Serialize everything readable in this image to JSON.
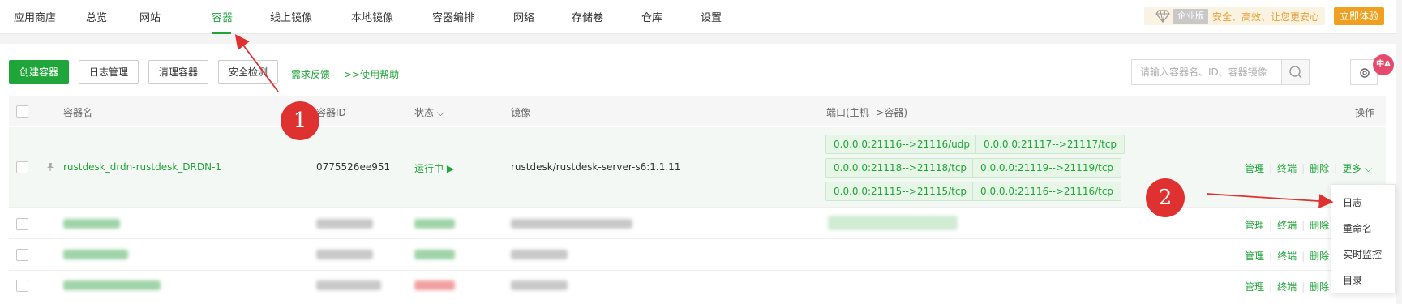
{
  "nav": {
    "items": [
      "应用商店",
      "总览",
      "网站",
      "容器",
      "线上镜像",
      "本地镜像",
      "容器编排",
      "网络",
      "存储卷",
      "仓库",
      "设置"
    ],
    "active": "容器"
  },
  "promo": {
    "tag": "企业版",
    "text": "安全、高效、让您更安心",
    "button": "立即体验"
  },
  "toolbar": {
    "create": "创建容器",
    "logs": "日志管理",
    "clean": "清理容器",
    "security": "安全检测",
    "feedback": "需求反馈",
    "help": ">>使用帮助"
  },
  "search": {
    "placeholder": "请输入容器名、ID、容器镜像"
  },
  "translate_badge": "中A",
  "table": {
    "headers": {
      "name": "容器名",
      "id": "容器ID",
      "status": "状态",
      "image": "镜像",
      "ports": "端口(主机-->容器)",
      "actions": "操作"
    },
    "row1": {
      "name": "rustdesk_drdn-rustdesk_DRDN-1",
      "id": "0775526ee951",
      "status": "运行中",
      "image": "rustdesk/rustdesk-server-s6:1.1.11",
      "ports": [
        "0.0.0.0:21116-->21116/udp",
        "0.0.0.0:21117-->21117/tcp",
        "0.0.0.0:21118-->21118/tcp",
        "0.0.0.0:21119-->21119/tcp",
        "0.0.0.0:21115-->21115/tcp",
        "0.0.0.0:21116-->21116/tcp"
      ]
    },
    "actions": {
      "manage": "管理",
      "terminal": "终端",
      "delete": "删除",
      "more": "更多"
    }
  },
  "dropdown": [
    "日志",
    "重命名",
    "实时监控",
    "目录"
  ],
  "annotations": [
    "1",
    "2"
  ],
  "colors": {
    "accent": "#20a53a",
    "promo": "#e6a23c",
    "annotation": "#e03131"
  }
}
